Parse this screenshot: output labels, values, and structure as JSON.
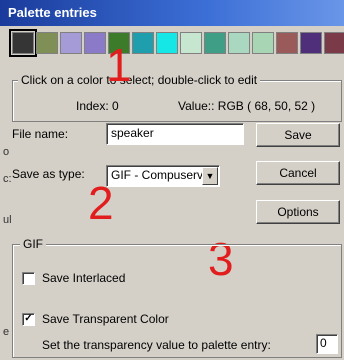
{
  "title": "Palette entries",
  "palette_colors": [
    "#353535",
    "#7f8f55",
    "#a59bd6",
    "#8a7ac8",
    "#3b7b2a",
    "#1f9eae",
    "#15e6e6",
    "#c7e6cf",
    "#3e9f86",
    "#a9d7bf",
    "#a8d6b5",
    "#9a5a5a",
    "#4f2e7a",
    "#7a3a48"
  ],
  "selected_index": 0,
  "hint": "Click on a color to select; double-click to edit",
  "index_text": "Index: 0",
  "value_text": "Value:: RGB ( 68, 50, 52 )",
  "file_name_label": "File name:",
  "file_name_value": "speaker",
  "save_as_type_label": "Save as type:",
  "save_as_type_value": "GIF - Compuserv",
  "save_button": "Save",
  "cancel_button": "Cancel",
  "options_button": "Options",
  "gif_group_label": "GIF",
  "save_interlaced_label": "Save Interlaced",
  "save_interlaced_checked": false,
  "save_transparent_label": "Save Transparent Color",
  "save_transparent_checked": true,
  "transparency_label": "Set the transparency value to palette entry:",
  "transparency_value": "0",
  "annotations": [
    "1",
    "2",
    "3"
  ],
  "side_chars": [
    "o",
    "c:",
    "ul",
    "e"
  ]
}
